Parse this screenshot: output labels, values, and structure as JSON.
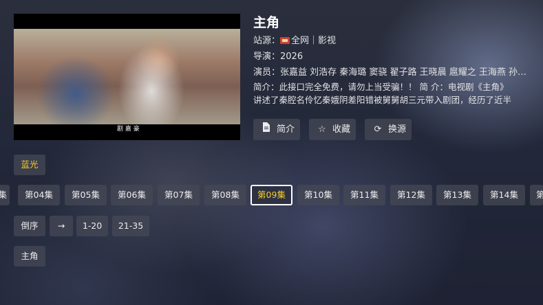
{
  "detail": {
    "title": "主角",
    "source_label": "站源：",
    "source_name": "全网｜影视",
    "director": "导演：2026",
    "cast": "演员：张嘉益 刘浩存 秦海璐 窦骁 翟子路 王晓晨 扈耀之 王海燕 孙…",
    "desc_line1": "简介：此接口完全免费，请勿上当受骗！！ 简 介：电视剧《主角》",
    "desc_line2": "讲述了秦腔名伶忆秦娥阴差阳错被舅舅胡三元带入剧团，经历了近半"
  },
  "player": {
    "subtitle_mark": "剧 嘉 豪"
  },
  "actions": [
    {
      "label": "简介",
      "icon": "document-icon"
    },
    {
      "label": "收藏",
      "icon": "star-icon"
    },
    {
      "label": "换源",
      "icon": "refresh-icon"
    }
  ],
  "quality": "蓝光",
  "episodes": [
    "集",
    "第04集",
    "第05集",
    "第06集",
    "第07集",
    "第08集",
    "第09集",
    "第10集",
    "第11集",
    "第12集",
    "第13集",
    "第14集",
    "第"
  ],
  "selected_episode": "第09集",
  "range_controls": {
    "reverse": "倒序",
    "arrow": "→",
    "range1": "1-20",
    "range2": "21-35"
  },
  "series_tag": "主角",
  "colors": {
    "accent": "#f3cd2a",
    "chip_bg": "#46485a"
  }
}
